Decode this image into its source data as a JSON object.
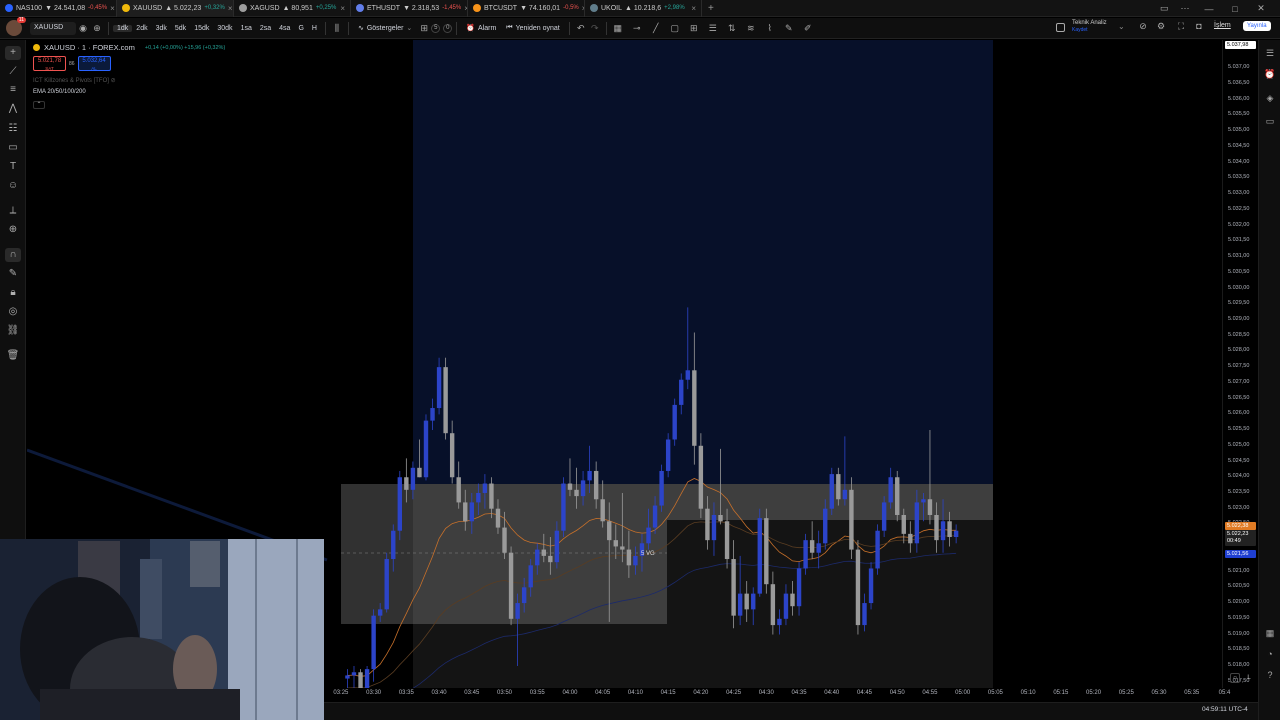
{
  "tabs": [
    {
      "symbol": "NAS100",
      "price": "24.541,08",
      "change": "-0,45%",
      "dir": "down",
      "dot": "#2962ff"
    },
    {
      "symbol": "XAUUSD",
      "price": "5.022,23",
      "change": "+0,32%",
      "dir": "up",
      "dot": "#f0b90b",
      "active": true
    },
    {
      "symbol": "XAGUSD",
      "price": "80,951",
      "change": "+0,25%",
      "dir": "up",
      "dot": "#9e9e9e"
    },
    {
      "symbol": "ETHUSDT",
      "price": "2.318,53",
      "change": "-1,45%",
      "dir": "down",
      "dot": "#627eea"
    },
    {
      "symbol": "BTCUSDT",
      "price": "74.160,01",
      "change": "-0,5%",
      "dir": "down",
      "dot": "#f7931a"
    },
    {
      "symbol": "UKOIL",
      "price": "10.218,6",
      "change": "+2,98%",
      "dir": "up",
      "dot": "#607d8b"
    }
  ],
  "toolbar": {
    "avatar_badge": "11",
    "symbol": "XAUUSD",
    "timeframes": [
      "1dk",
      "2dk",
      "3dk",
      "5dk",
      "15dk",
      "30dk",
      "1sa",
      "2sa",
      "4sa",
      "G",
      "H"
    ],
    "active_timeframe": "1dk",
    "indicators_label": "Göstergeler",
    "alarm_label": "Alarm",
    "replay_label": "Yeniden oynat",
    "layout_count_a": "5",
    "layout_count_b": "0",
    "tech_analysis_label": "Teknik Analiz",
    "tech_analysis_sub": "Kaydet",
    "trade_label": "İşlem",
    "publish_label": "Yayınla"
  },
  "legend": {
    "title": "XAUUSD · 1 · FOREX.com",
    "change_text": "+0,14 (+0,00%) +15,96 (+0,32%)",
    "sell_price": "5.021,78",
    "sell_label": "SAT",
    "buy_price": "5.032,64",
    "buy_label": "AL",
    "spread": "86",
    "indicator_1": "ICT Killzones & Pivots [TFO]",
    "indicator_2": "EMA 20/50/100/200"
  },
  "price_scale": {
    "labels": [
      "5.037,00",
      "5.036,50",
      "5.036,00",
      "5.035,50",
      "5.035,00",
      "5.034,50",
      "5.034,00",
      "5.033,50",
      "5.033,00",
      "5.032,50",
      "5.032,00",
      "5.031,50",
      "5.031,00",
      "5.030,50",
      "5.030,00",
      "5.029,50",
      "5.029,00",
      "5.028,50",
      "5.028,00",
      "5.027,50",
      "5.027,00",
      "5.026,50",
      "5.026,00",
      "5.025,50",
      "5.025,00",
      "5.024,50",
      "5.024,00",
      "5.023,50",
      "5.023,00",
      "5.022,50",
      "5.022,00",
      "5.021,50",
      "5.021,00",
      "5.020,50",
      "5.020,00",
      "5.019,50",
      "5.019,00",
      "5.018,50",
      "5.018,00",
      "5.017,50"
    ],
    "top_tag": "5.037,98",
    "current_price": "5.022,23",
    "orange_tag": "5.022,38",
    "countdown": "00:49",
    "blue_tag": "5.021,56"
  },
  "time_axis": [
    "03:25",
    "03:30",
    "03:35",
    "03:40",
    "03:45",
    "03:50",
    "03:55",
    "04:00",
    "04:05",
    "04:10",
    "04:15",
    "04:20",
    "04:25",
    "04:30",
    "04:35",
    "04:40",
    "04:45",
    "04:50",
    "04:55",
    "05:00",
    "05:05",
    "05:10",
    "05:15",
    "05:20",
    "05:25",
    "05:30",
    "05:35",
    "05:4"
  ],
  "clock": "04:59:11 UTC-4",
  "chart_marker": "5 VG",
  "chart_data": {
    "type": "candlestick",
    "symbol": "XAUUSD",
    "interval": "1",
    "x": [
      "03:26",
      "03:27",
      "03:28",
      "03:29",
      "03:30",
      "03:31",
      "03:32",
      "03:33",
      "03:34",
      "03:35",
      "03:36",
      "03:37",
      "03:38",
      "03:39",
      "03:40",
      "03:41",
      "03:42",
      "03:43",
      "03:44",
      "03:45",
      "03:46",
      "03:47",
      "03:48",
      "03:49",
      "03:50",
      "03:51",
      "03:52",
      "03:53",
      "03:54",
      "03:55",
      "03:56",
      "03:57",
      "03:58",
      "03:59",
      "04:00",
      "04:01",
      "04:02",
      "04:03",
      "04:04",
      "04:05",
      "04:06",
      "04:07",
      "04:08",
      "04:09",
      "04:10",
      "04:11",
      "04:12",
      "04:13",
      "04:14",
      "04:15",
      "04:16",
      "04:17",
      "04:18",
      "04:19",
      "04:20",
      "04:21",
      "04:22",
      "04:23",
      "04:24",
      "04:25",
      "04:26",
      "04:27",
      "04:28",
      "04:29",
      "04:30",
      "04:31",
      "04:32",
      "04:33",
      "04:34",
      "04:35",
      "04:36",
      "04:37",
      "04:38",
      "04:39",
      "04:40",
      "04:41",
      "04:42",
      "04:43",
      "04:44",
      "04:45",
      "04:46",
      "04:47",
      "04:48",
      "04:49",
      "04:50",
      "04:51",
      "04:52",
      "04:53",
      "04:54",
      "04:55",
      "04:56",
      "04:57",
      "04:58",
      "04:59"
    ],
    "ohlc": [
      [
        5017.6,
        5017.9,
        5017.2,
        5017.7
      ],
      [
        5017.7,
        5018.0,
        5017.0,
        5017.8
      ],
      [
        5017.8,
        5017.9,
        5017.1,
        5017.3
      ],
      [
        5017.3,
        5018.0,
        5017.2,
        5017.9
      ],
      [
        5017.9,
        5019.8,
        5017.5,
        5019.6
      ],
      [
        5019.6,
        5020.0,
        5019.4,
        5019.8
      ],
      [
        5019.8,
        5021.6,
        5019.7,
        5021.4
      ],
      [
        5021.4,
        5022.5,
        5021.0,
        5022.3
      ],
      [
        5022.3,
        5024.2,
        5022.0,
        5024.0
      ],
      [
        5024.0,
        5024.6,
        5023.2,
        5023.6
      ],
      [
        5023.6,
        5024.5,
        5023.3,
        5024.3
      ],
      [
        5024.3,
        5025.2,
        5024.0,
        5024.0
      ],
      [
        5024.0,
        5026.0,
        5023.9,
        5025.8
      ],
      [
        5025.8,
        5026.5,
        5025.5,
        5026.2
      ],
      [
        5026.2,
        5027.8,
        5026.0,
        5027.5
      ],
      [
        5027.5,
        5027.8,
        5025.2,
        5025.4
      ],
      [
        5025.4,
        5025.8,
        5023.8,
        5024.0
      ],
      [
        5024.0,
        5024.5,
        5023.0,
        5023.2
      ],
      [
        5023.2,
        5023.6,
        5022.3,
        5022.6
      ],
      [
        5022.6,
        5023.5,
        5022.2,
        5023.2
      ],
      [
        5023.2,
        5023.8,
        5022.8,
        5023.5
      ],
      [
        5023.5,
        5024.1,
        5023.0,
        5023.8
      ],
      [
        5023.8,
        5024.0,
        5022.7,
        5023.0
      ],
      [
        5023.0,
        5023.3,
        5022.2,
        5022.4
      ],
      [
        5022.4,
        5022.9,
        5021.4,
        5021.6
      ],
      [
        5021.6,
        5021.8,
        5019.3,
        5019.5
      ],
      [
        5019.5,
        5020.3,
        5018.0,
        5020.0
      ],
      [
        5020.0,
        5020.8,
        5019.7,
        5020.5
      ],
      [
        5020.5,
        5021.4,
        5020.2,
        5021.2
      ],
      [
        5021.2,
        5021.9,
        5020.9,
        5021.7
      ],
      [
        5021.7,
        5022.2,
        5021.3,
        5021.5
      ],
      [
        5021.5,
        5022.1,
        5020.9,
        5021.3
      ],
      [
        5021.3,
        5022.6,
        5021.1,
        5022.3
      ],
      [
        5022.3,
        5024.0,
        5022.1,
        5023.8
      ],
      [
        5023.8,
        5024.6,
        5023.4,
        5023.6
      ],
      [
        5023.6,
        5024.3,
        5023.0,
        5023.4
      ],
      [
        5023.4,
        5024.2,
        5023.1,
        5023.9
      ],
      [
        5023.9,
        5025.0,
        5023.5,
        5024.2
      ],
      [
        5024.2,
        5024.5,
        5023.0,
        5023.3
      ],
      [
        5023.3,
        5023.9,
        5022.4,
        5022.6
      ],
      [
        5022.6,
        5023.2,
        5019.4,
        5022.0
      ],
      [
        5022.0,
        5022.5,
        5021.4,
        5021.8
      ],
      [
        5021.8,
        5023.5,
        5021.3,
        5021.7
      ],
      [
        5021.7,
        5022.3,
        5020.8,
        5021.2
      ],
      [
        5021.2,
        5021.8,
        5020.9,
        5021.5
      ],
      [
        5021.5,
        5022.2,
        5021.0,
        5021.9
      ],
      [
        5021.9,
        5023.0,
        5021.7,
        5022.4
      ],
      [
        5022.4,
        5023.4,
        5022.2,
        5023.1
      ],
      [
        5023.1,
        5024.4,
        5022.9,
        5024.2
      ],
      [
        5024.2,
        5025.4,
        5024.0,
        5025.2
      ],
      [
        5025.2,
        5026.5,
        5025.0,
        5026.3
      ],
      [
        5026.3,
        5027.3,
        5026.0,
        5027.1
      ],
      [
        5027.1,
        5029.4,
        5026.8,
        5027.4
      ],
      [
        5027.4,
        5028.6,
        5024.4,
        5025.0
      ],
      [
        5025.0,
        5025.4,
        5022.7,
        5023.0
      ],
      [
        5023.0,
        5023.4,
        5021.7,
        5022.0
      ],
      [
        5022.0,
        5023.2,
        5021.5,
        5022.8
      ],
      [
        5022.8,
        5024.9,
        5022.5,
        5022.6
      ],
      [
        5022.6,
        5023.0,
        5021.1,
        5021.4
      ],
      [
        5021.4,
        5022.0,
        5019.2,
        5019.6
      ],
      [
        5019.6,
        5021.5,
        5019.3,
        5020.3
      ],
      [
        5020.3,
        5020.7,
        5019.4,
        5019.8
      ],
      [
        5019.8,
        5020.5,
        5019.3,
        5020.3
      ],
      [
        5020.3,
        5023.0,
        5020.2,
        5022.7
      ],
      [
        5022.7,
        5023.0,
        5020.3,
        5020.6
      ],
      [
        5020.6,
        5021.0,
        5019.0,
        5019.3
      ],
      [
        5019.3,
        5019.8,
        5019.0,
        5019.5
      ],
      [
        5019.5,
        5020.6,
        5019.3,
        5020.3
      ],
      [
        5020.3,
        5020.7,
        5019.6,
        5019.9
      ],
      [
        5019.9,
        5021.3,
        5019.6,
        5021.1
      ],
      [
        5021.1,
        5022.2,
        5020.9,
        5022.0
      ],
      [
        5022.0,
        5022.6,
        5021.4,
        5021.6
      ],
      [
        5021.6,
        5022.3,
        5021.1,
        5021.9
      ],
      [
        5021.9,
        5023.3,
        5021.7,
        5023.0
      ],
      [
        5023.0,
        5024.3,
        5022.8,
        5024.1
      ],
      [
        5024.1,
        5024.3,
        5023.1,
        5023.3
      ],
      [
        5023.3,
        5025.3,
        5023.1,
        5023.6
      ],
      [
        5023.6,
        5024.0,
        5021.4,
        5021.7
      ],
      [
        5021.7,
        5022.0,
        5019.0,
        5019.3
      ],
      [
        5019.3,
        5020.3,
        5019.1,
        5020.0
      ],
      [
        5020.0,
        5021.3,
        5019.8,
        5021.1
      ],
      [
        5021.1,
        5022.5,
        5020.9,
        5022.3
      ],
      [
        5022.3,
        5023.4,
        5022.1,
        5023.2
      ],
      [
        5023.2,
        5024.3,
        5023.0,
        5024.0
      ],
      [
        5024.0,
        5024.2,
        5022.6,
        5022.8
      ],
      [
        5022.8,
        5023.0,
        5021.9,
        5022.2
      ],
      [
        5022.2,
        5022.6,
        5021.6,
        5021.9
      ],
      [
        5021.9,
        5023.6,
        5021.6,
        5023.2
      ],
      [
        5023.2,
        5023.5,
        5022.6,
        5023.3
      ],
      [
        5023.3,
        5025.5,
        5022.5,
        5022.8
      ],
      [
        5022.8,
        5023.2,
        5021.6,
        5022.0
      ],
      [
        5022.0,
        5023.3,
        5021.6,
        5022.6
      ],
      [
        5022.6,
        5022.9,
        5021.8,
        5022.1
      ],
      [
        5022.1,
        5022.5,
        5021.9,
        5022.3
      ]
    ],
    "ylim": [
      5017.3,
      5037.9
    ],
    "y_ticks_step": 0.5,
    "background_zone": "04:38 session highlighted"
  }
}
